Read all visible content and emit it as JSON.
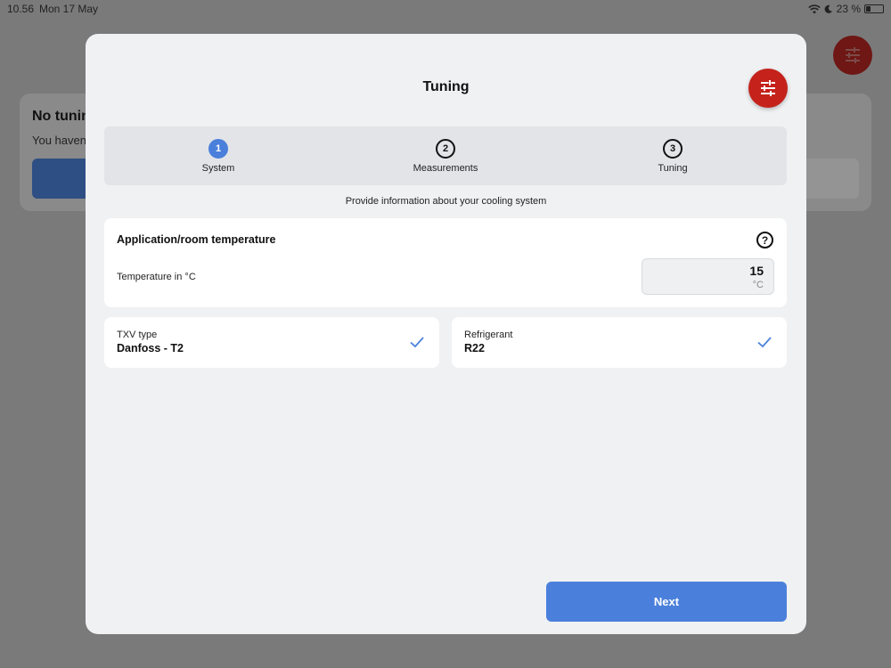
{
  "status_bar": {
    "time": "10.56",
    "date": "Mon 17 May",
    "battery": "23 %"
  },
  "background": {
    "title": "No tunin",
    "text": "You haven'"
  },
  "modal": {
    "title": "Tuning",
    "steps": [
      {
        "number": "1",
        "label": "System",
        "active": true
      },
      {
        "number": "2",
        "label": "Measurements",
        "active": false
      },
      {
        "number": "3",
        "label": "Tuning",
        "active": false
      }
    ],
    "subtitle": "Provide information about your cooling system",
    "temperature_card": {
      "heading": "Application/room temperature",
      "help_icon": "?",
      "field_label": "Temperature in °C",
      "value": "15",
      "unit": "°C"
    },
    "txv": {
      "label": "TXV type",
      "value": "Danfoss - T2"
    },
    "refrigerant": {
      "label": "Refrigerant",
      "value": "R22"
    },
    "next_label": "Next"
  },
  "colors": {
    "accent_blue": "#4a80db",
    "fab_red": "#c4221b",
    "modal_bg": "#f0f1f3"
  },
  "icons": {
    "fab": "sliders-icon",
    "help": "question-circle-icon",
    "check": "checkmark-icon"
  }
}
